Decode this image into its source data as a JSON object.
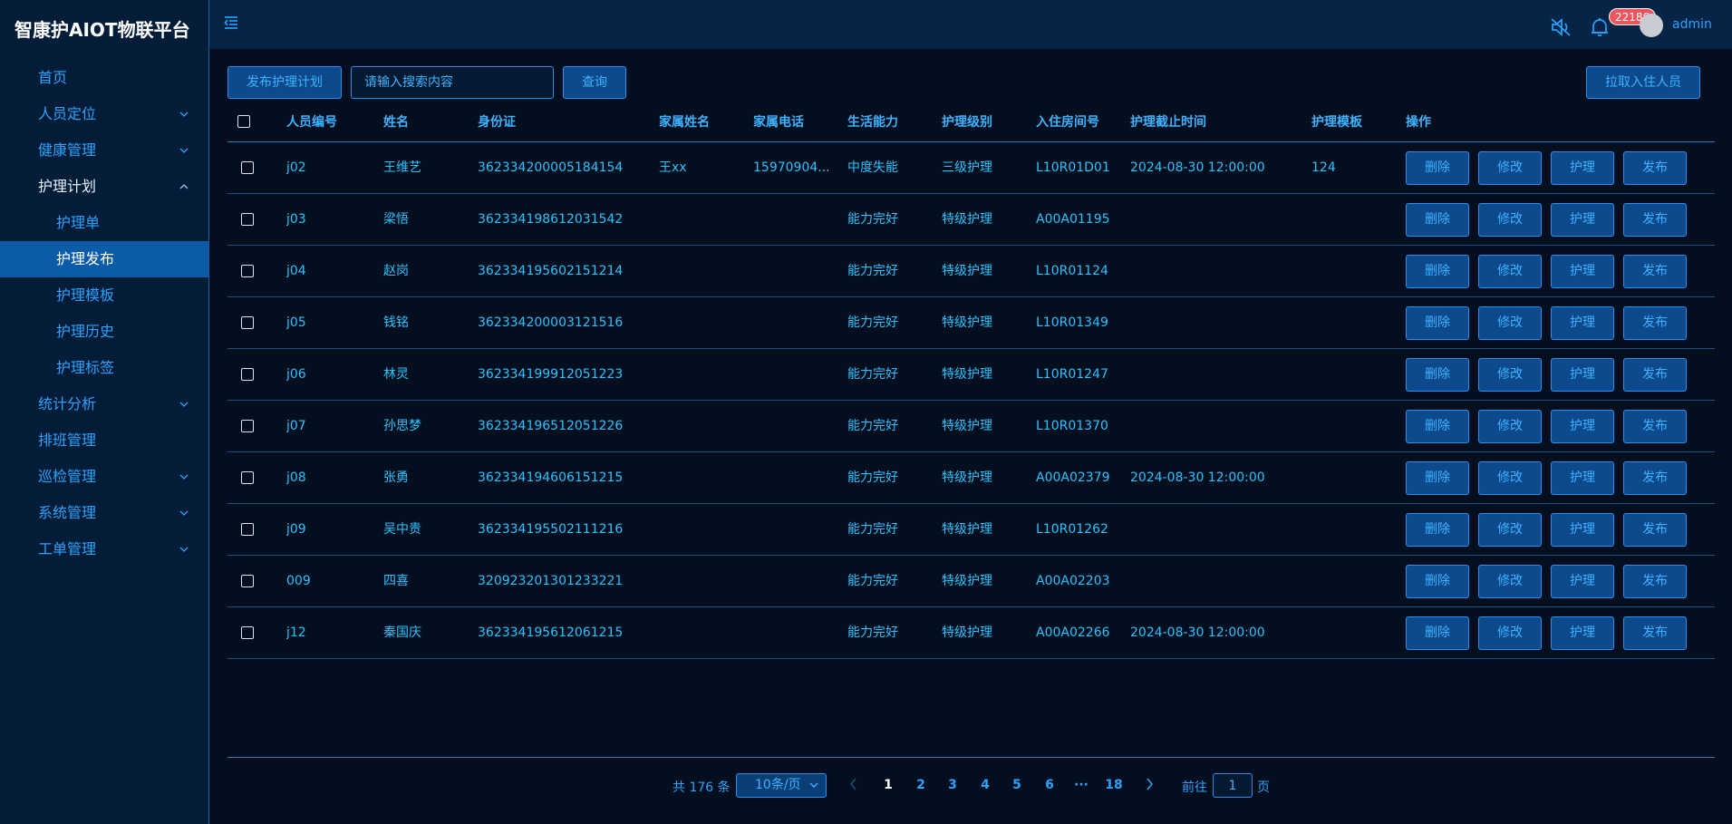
{
  "app": {
    "title": "智康护AIOT物联平台"
  },
  "sidebar": {
    "items": [
      {
        "label": "首页",
        "chevron": "none",
        "level": 1
      },
      {
        "label": "人员定位",
        "chevron": "down",
        "level": 1
      },
      {
        "label": "健康管理",
        "chevron": "down",
        "level": 1
      },
      {
        "label": "护理计划",
        "chevron": "up",
        "level": 1,
        "open": true
      },
      {
        "label": "护理单",
        "chevron": "none",
        "level": 2
      },
      {
        "label": "护理发布",
        "chevron": "none",
        "level": 2,
        "active": true
      },
      {
        "label": "护理模板",
        "chevron": "none",
        "level": 2
      },
      {
        "label": "护理历史",
        "chevron": "none",
        "level": 2
      },
      {
        "label": "护理标签",
        "chevron": "none",
        "level": 2
      },
      {
        "label": "统计分析",
        "chevron": "down",
        "level": 1
      },
      {
        "label": "排班管理",
        "chevron": "none",
        "level": 1
      },
      {
        "label": "巡检管理",
        "chevron": "down",
        "level": 1
      },
      {
        "label": "系统管理",
        "chevron": "down",
        "level": 1
      },
      {
        "label": "工单管理",
        "chevron": "down",
        "level": 1
      }
    ]
  },
  "header": {
    "notification_count": "22186",
    "username": "admin",
    "icons": [
      "menu-collapse-icon",
      "sound-muted-icon",
      "bell-icon",
      "avatar"
    ]
  },
  "toolbar": {
    "publish_label": "发布护理计划",
    "search_placeholder": "请输入搜索内容",
    "query_label": "查询",
    "pull_residents_label": "拉取入住人员"
  },
  "table": {
    "headers": [
      "人员编号",
      "姓名",
      "身份证",
      "家属姓名",
      "家属电话",
      "生活能力",
      "护理级别",
      "入住房间号",
      "护理截止时间",
      "护理模板",
      "操作"
    ],
    "actions": [
      "删除",
      "修改",
      "护理",
      "发布"
    ],
    "rows": [
      {
        "id": "j02",
        "name": "王维艺",
        "idcard": "362334200005184154",
        "family_name": "王xx",
        "family_phone": "15970904...",
        "ability": "中度失能",
        "level": "三级护理",
        "room": "L10R01D01",
        "deadline": "2024-08-30 12:00:00",
        "template": "124"
      },
      {
        "id": "j03",
        "name": "梁悟",
        "idcard": "362334198612031542",
        "family_name": "",
        "family_phone": "",
        "ability": "能力完好",
        "level": "特级护理",
        "room": "A00A01195",
        "deadline": "",
        "template": ""
      },
      {
        "id": "j04",
        "name": "赵岗",
        "idcard": "362334195602151214",
        "family_name": "",
        "family_phone": "",
        "ability": "能力完好",
        "level": "特级护理",
        "room": "L10R01124",
        "deadline": "",
        "template": ""
      },
      {
        "id": "j05",
        "name": "钱铭",
        "idcard": "362334200003121516",
        "family_name": "",
        "family_phone": "",
        "ability": "能力完好",
        "level": "特级护理",
        "room": "L10R01349",
        "deadline": "",
        "template": ""
      },
      {
        "id": "j06",
        "name": "林灵",
        "idcard": "362334199912051223",
        "family_name": "",
        "family_phone": "",
        "ability": "能力完好",
        "level": "特级护理",
        "room": "L10R01247",
        "deadline": "",
        "template": ""
      },
      {
        "id": "j07",
        "name": "孙思梦",
        "idcard": "362334196512051226",
        "family_name": "",
        "family_phone": "",
        "ability": "能力完好",
        "level": "特级护理",
        "room": "L10R01370",
        "deadline": "",
        "template": ""
      },
      {
        "id": "j08",
        "name": "张勇",
        "idcard": "362334194606151215",
        "family_name": "",
        "family_phone": "",
        "ability": "能力完好",
        "level": "特级护理",
        "room": "A00A02379",
        "deadline": "2024-08-30 12:00:00",
        "template": ""
      },
      {
        "id": "j09",
        "name": "吴中贵",
        "idcard": "362334195502111216",
        "family_name": "",
        "family_phone": "",
        "ability": "能力完好",
        "level": "特级护理",
        "room": "L10R01262",
        "deadline": "",
        "template": ""
      },
      {
        "id": "009",
        "name": "四喜",
        "idcard": "320923201301233221",
        "family_name": "",
        "family_phone": "",
        "ability": "能力完好",
        "level": "特级护理",
        "room": "A00A02203",
        "deadline": "",
        "template": ""
      },
      {
        "id": "j12",
        "name": "秦国庆",
        "idcard": "362334195612061215",
        "family_name": "",
        "family_phone": "",
        "ability": "能力完好",
        "level": "特级护理",
        "room": "A00A02266",
        "deadline": "2024-08-30 12:00:00",
        "template": ""
      }
    ]
  },
  "pagination": {
    "total_text": "共 176 条",
    "page_size": "10条/页",
    "pages": [
      "1",
      "2",
      "3",
      "4",
      "5",
      "6",
      "···",
      "18"
    ],
    "current_page": "1",
    "goto_prefix": "前往",
    "goto_value": "1",
    "goto_suffix": "页"
  },
  "colors": {
    "background": "#030f1f",
    "sidebar": "#031c38",
    "header": "#062546",
    "accent": "#29a3ff",
    "button_bg": "#0c4a8c",
    "active_menu": "#0b5ba8",
    "badge": "#f1545c"
  }
}
